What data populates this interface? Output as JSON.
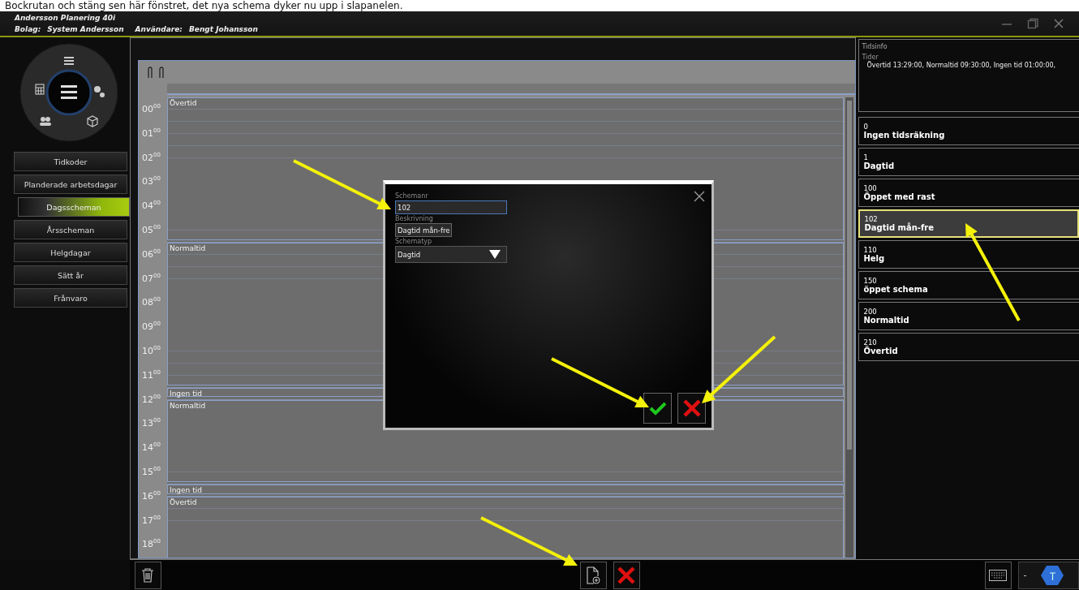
{
  "caption": "Bockrutan och stäng sen här fönstret, det nya schema dyker nu upp i slapanelen.",
  "titlebar": {
    "app_title": "Andersson Planering 40i",
    "company_label": "Bolag:",
    "company": "System Andersson",
    "user_label": "Användare:",
    "user": "Bengt Johansson"
  },
  "nav": [
    {
      "label": "Tidkoder",
      "selected": false
    },
    {
      "label": "Planderade arbetsdagar",
      "selected": false
    },
    {
      "label": "Dagsscheman",
      "selected": true
    },
    {
      "label": "Årsscheman",
      "selected": false
    },
    {
      "label": "Helgdagar",
      "selected": false
    },
    {
      "label": "Sätt år",
      "selected": false
    },
    {
      "label": "Frånvaro",
      "selected": false
    }
  ],
  "calendar": {
    "hours": [
      "00$^{00}$",
      "01$^{00}$",
      "02$^{00}$",
      "03$^{00}$",
      "04$^{00}$",
      "05$^{00}$",
      "06$^{00}$",
      "07$^{00}$",
      "08$^{00}$",
      "09$^{00}$",
      "10$^{00}$",
      "11$^{00}$",
      "12$^{00}$",
      "13$^{00}$",
      "14$^{00}$",
      "15$^{00}$",
      "16$^{00}$",
      "17$^{00}$",
      "18$^{00}$"
    ],
    "blocks": [
      {
        "label": "Övertid"
      },
      {
        "label": "Normaltid"
      },
      {
        "label": "Ingen tid"
      },
      {
        "label": "Normaltid"
      },
      {
        "label": "Ingen tid"
      },
      {
        "label": "Övertid"
      }
    ]
  },
  "dialog": {
    "fields": [
      {
        "kind": "text",
        "label": "Schemanr",
        "value": "102",
        "focused": true
      },
      {
        "kind": "text",
        "label": "Beskrivning",
        "value": "Dagtid mån-fre",
        "focused": false
      },
      {
        "kind": "select",
        "label": "Schematyp",
        "value": "Dagtid",
        "focused": false
      }
    ]
  },
  "time_info": {
    "title": "Tidsinfo",
    "label": "Tider",
    "text": "Övertid 13:29:00,  Normaltid 09:30:00,  Ingen tid 01:00:00,"
  },
  "schedules": [
    {
      "number": "0",
      "name": "Ingen tidsräkning",
      "selected": false
    },
    {
      "number": "1",
      "name": "Dagtid",
      "selected": false
    },
    {
      "number": "100",
      "name": "Öppet med rast",
      "selected": false
    },
    {
      "number": "102",
      "name": "Dagtid mån-fre",
      "selected": true
    },
    {
      "number": "110",
      "name": "Helg",
      "selected": false
    },
    {
      "number": "150",
      "name": "öppet schema",
      "selected": false
    },
    {
      "number": "200",
      "name": "Normaltid",
      "selected": false
    },
    {
      "number": "210",
      "name": "Övertid",
      "selected": false
    }
  ],
  "bottom_bar": {
    "zoom_text": "-"
  }
}
